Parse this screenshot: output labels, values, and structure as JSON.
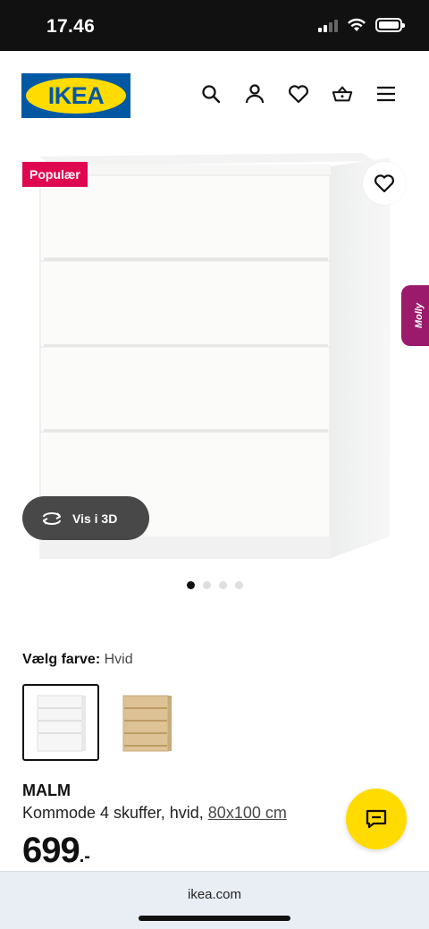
{
  "status_bar": {
    "time": "17.46"
  },
  "header": {
    "logo_text": "IKEA",
    "icons": [
      "search-icon",
      "account-icon",
      "favorites-icon",
      "basket-icon",
      "menu-icon"
    ]
  },
  "gallery": {
    "badge": "Populær",
    "assistant_tab": "Molly",
    "view3d_label": "Vis i 3D",
    "image_count": 4,
    "active_image": 1
  },
  "color_choice": {
    "label": "Vælg farve:",
    "value": "Hvid",
    "swatches": [
      {
        "name": "Hvid",
        "selected": true
      },
      {
        "name": "Hvidpigmenteret egetræsfinér",
        "selected": false
      }
    ]
  },
  "product": {
    "name": "MALM",
    "description": "Kommode 4 skuffer, hvid,",
    "size": "80x100 cm",
    "price_integer": "699",
    "price_suffix": ".-"
  },
  "browser": {
    "url": "ikea.com"
  },
  "colors": {
    "ikea_blue": "#0058a3",
    "ikea_yellow": "#ffdb00",
    "badge_red": "#e00751",
    "molly_purple": "#9b1a6b"
  }
}
